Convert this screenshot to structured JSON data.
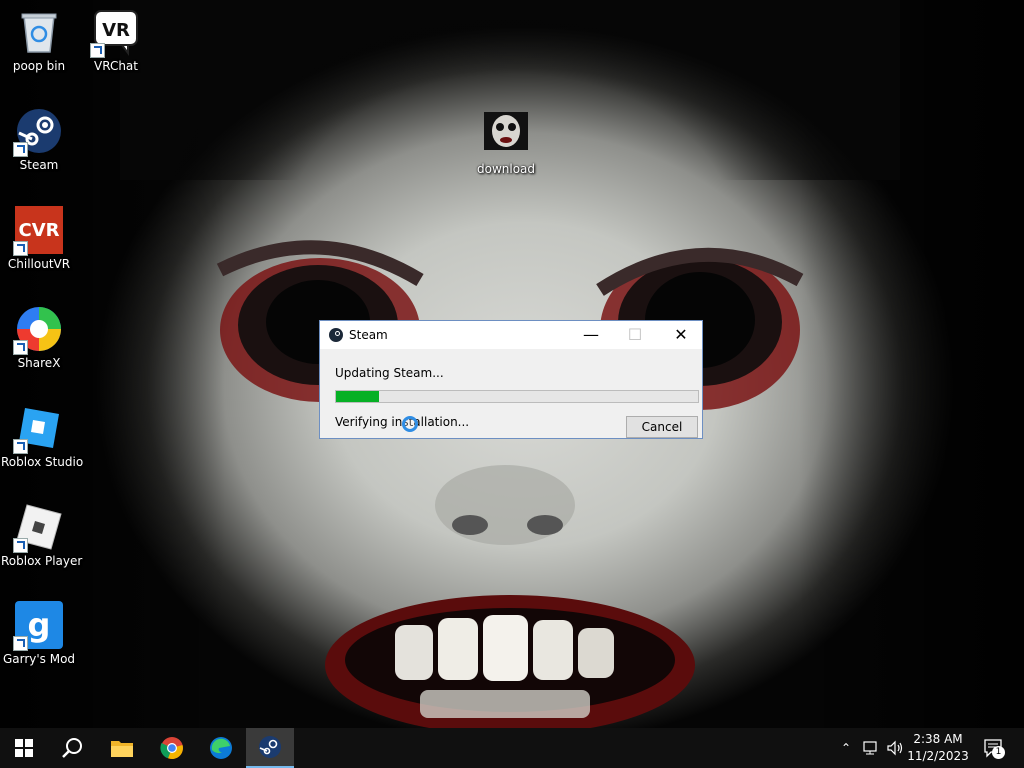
{
  "desktop": {
    "icons": [
      {
        "label": "poop bin",
        "icon": "recycle-bin-icon"
      },
      {
        "label": "VRChat",
        "icon": "vrchat-icon"
      },
      {
        "label": "Steam",
        "icon": "steam-icon"
      },
      {
        "label": "download",
        "icon": "image-file-icon"
      },
      {
        "label": "ChilloutVR",
        "icon": "chilloutvr-icon"
      },
      {
        "label": "ShareX",
        "icon": "sharex-icon"
      },
      {
        "label": "Roblox Studio",
        "icon": "roblox-studio-icon"
      },
      {
        "label": "Roblox Player",
        "icon": "roblox-player-icon"
      },
      {
        "label": "Garry's Mod",
        "icon": "garrysmod-icon"
      }
    ]
  },
  "dialog": {
    "title": "Steam",
    "status_top": "Updating Steam...",
    "status_bottom": "Verifying installation...",
    "progress": 0.12,
    "cancel_label": "Cancel",
    "minimize_glyph": "—",
    "maximize_glyph": "☐",
    "close_glyph": "✕"
  },
  "taskbar": {
    "items": [
      "start-icon",
      "search-icon",
      "file-explorer-icon",
      "chrome-icon",
      "edge-icon",
      "steam-icon"
    ],
    "clock_time": "2:38 AM",
    "clock_date": "11/2/2023",
    "notification_count": "1"
  },
  "colors": {
    "progress_fill": "#06b025",
    "dialog_border": "#6d8fc2",
    "taskbar_bg": "#101010"
  }
}
